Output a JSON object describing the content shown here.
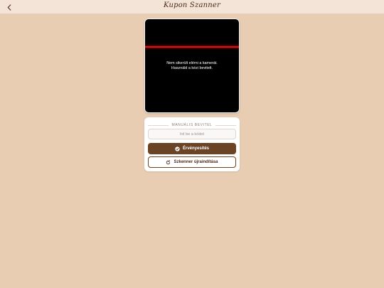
{
  "header": {
    "title": "Kupon Szanner",
    "back_icon": "chevron-left-icon"
  },
  "camera": {
    "message_line1": "Nem sikerült elérni a kamerát.",
    "message_line2": "Használd a kézi bevitelt.",
    "scan_line_color": "#dd1111"
  },
  "manual": {
    "section_label": "MANUÁLIS BEVITEL",
    "input_placeholder": "Írd be a kódot",
    "input_value": "",
    "validate_label": "Érvényesítés",
    "validate_icon": "check-circle-icon",
    "restart_label": "Szkenner újraindítása",
    "restart_icon": "refresh-icon"
  },
  "colors": {
    "background": "#e8cdb3",
    "header": "#f3e4d7",
    "primary": "#6b4325"
  }
}
